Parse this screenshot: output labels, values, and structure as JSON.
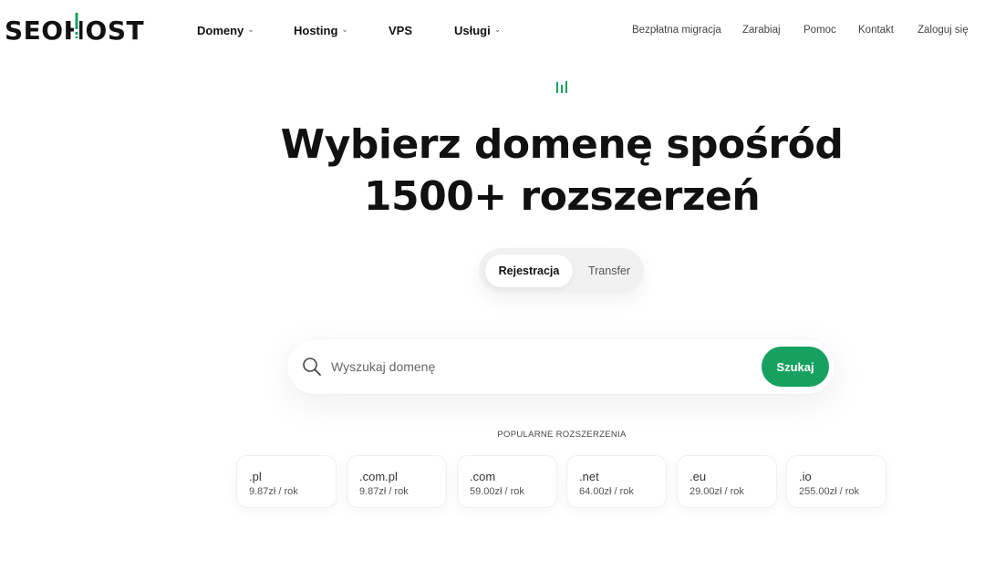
{
  "header": {
    "logo": {
      "text_before": "SEO",
      "text_h": "H",
      "text_after": "OST"
    },
    "nav_main": [
      {
        "label": "Domeny",
        "dropdown": true
      },
      {
        "label": "Hosting",
        "dropdown": true
      },
      {
        "label": "VPS",
        "dropdown": false
      },
      {
        "label": "Usługi",
        "dropdown": true
      }
    ],
    "nav_right": [
      {
        "label": "Bezpłatna migracja"
      },
      {
        "label": "Zarabiaj"
      },
      {
        "label": "Pomoc"
      },
      {
        "label": "Kontakt"
      },
      {
        "label": "Zaloguj się"
      }
    ]
  },
  "hero": {
    "icon": "bars-icon",
    "title_line1": "Wybierz domenę spośród",
    "title_line2": "1500+ rozszerzeń"
  },
  "toggle": {
    "options": [
      "Rejestracja",
      "Transfer"
    ],
    "selected": "Rejestracja"
  },
  "search": {
    "placeholder": "Wyszukaj domenę",
    "value": "",
    "button_label": "Szukaj",
    "icon": "search-icon"
  },
  "popular": {
    "label": "POPULARNE ROZSZERZENIA",
    "extensions": [
      {
        "name": ".pl",
        "price": "9.87zł / rok"
      },
      {
        "name": ".com.pl",
        "price": "9.87zł / rok"
      },
      {
        "name": ".com",
        "price": "59.00zł / rok"
      },
      {
        "name": ".net",
        "price": "64.00zł / rok"
      },
      {
        "name": ".eu",
        "price": "29.00zł / rok"
      },
      {
        "name": ".io",
        "price": "255.00zł / rok"
      }
    ]
  },
  "colors": {
    "accent": "#17a160",
    "text": "#111111",
    "toggle_bg": "#f1f1f1"
  }
}
